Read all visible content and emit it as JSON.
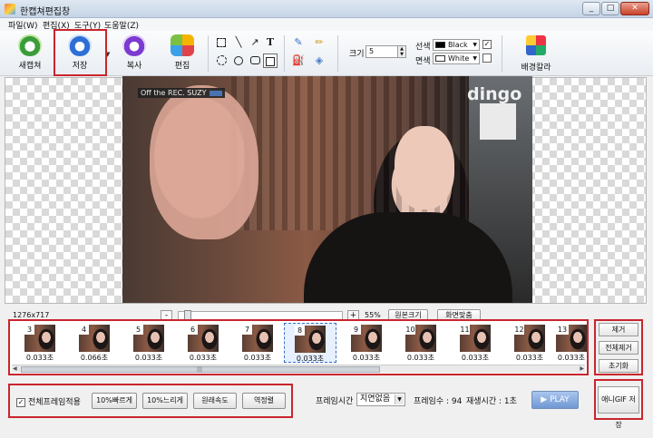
{
  "window": {
    "title": "한캡쳐편집창",
    "buttons": [
      "_",
      "□",
      "✕"
    ]
  },
  "menu": [
    "파일(W)",
    "편집(X)",
    "도구(Y)",
    "도움말(Z)"
  ],
  "toolbar": {
    "new_label": "새캡쳐",
    "save_label": "저장",
    "copy_label": "복사",
    "edit_label": "편집",
    "size_label": "크기",
    "size_value": "5",
    "line_label": "선색",
    "line_color": "Black",
    "line_color_hex": "#000000",
    "fill_label": "면색",
    "fill_color": "White",
    "fill_color_hex": "#ffffff",
    "line_checked": "✓",
    "background_label": "배경칼라"
  },
  "canvas": {
    "overlay_text": "Off the REC. SUZY",
    "watermark": "dingo"
  },
  "zoom": {
    "dimensions": "1276x717",
    "minus": "-",
    "plus": "+",
    "percent": "55%",
    "original_size": "원본크기",
    "fit_screen": "화면맞춤"
  },
  "frames": [
    {
      "num": "3",
      "dur": "0.033초"
    },
    {
      "num": "4",
      "dur": "0.066초"
    },
    {
      "num": "5",
      "dur": "0.033초"
    },
    {
      "num": "6",
      "dur": "0.033초"
    },
    {
      "num": "7",
      "dur": "0.033초"
    },
    {
      "num": "8",
      "dur": "0.033초"
    },
    {
      "num": "9",
      "dur": "0.033초"
    },
    {
      "num": "10",
      "dur": "0.033초"
    },
    {
      "num": "11",
      "dur": "0.033초"
    },
    {
      "num": "12",
      "dur": "0.033초"
    },
    {
      "num": "13",
      "dur": "0.033초"
    }
  ],
  "frame_actions": {
    "remove": "제거",
    "remove_all": "전체제거",
    "reset": "초기화"
  },
  "bottom": {
    "apply_all": "전체프레임적용",
    "faster": "10%빠르게",
    "slower": "10%느리게",
    "original_speed": "원래속도",
    "reverse": "역정렬",
    "frame_time_label": "프레임시간",
    "frame_time_value": "지연없음",
    "frame_count": "프레임수 : 94",
    "play_time": "재생시간 : 1초",
    "play": "▶ PLAY",
    "save_gif": "애니GIF 저장"
  }
}
